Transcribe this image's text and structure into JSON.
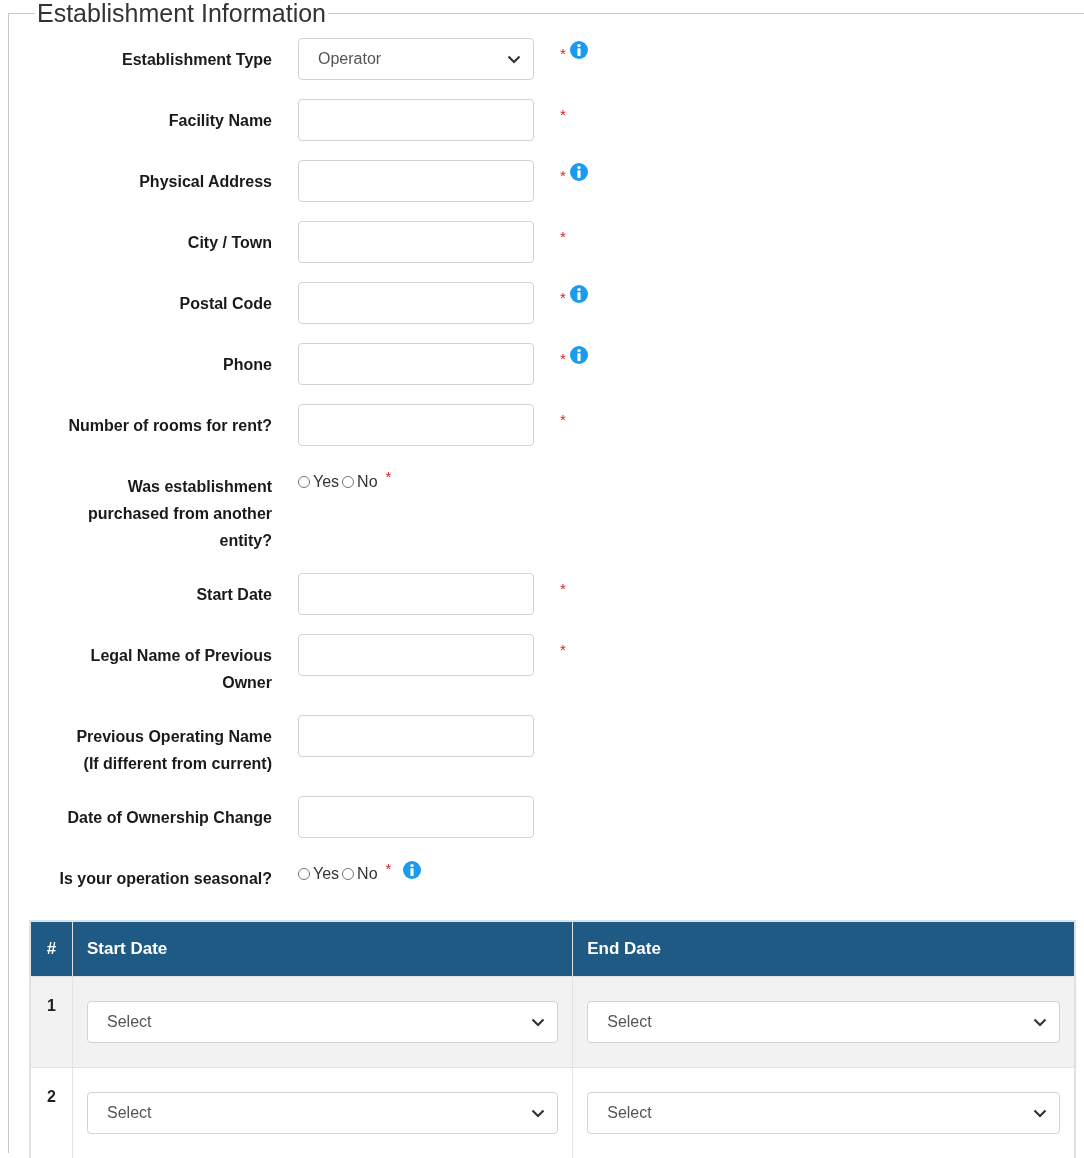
{
  "fieldset": {
    "legend": "Establishment Information"
  },
  "fields": [
    {
      "kind": "select",
      "label": "Establishment Type",
      "value": "Operator",
      "required_mark": "*",
      "info": true
    },
    {
      "kind": "text",
      "label": "Facility Name",
      "required_mark": "*",
      "info": false
    },
    {
      "kind": "text",
      "label": "Physical Address",
      "required_mark": "*",
      "info": true
    },
    {
      "kind": "text",
      "label": "City / Town",
      "required_mark": "*",
      "info": false
    },
    {
      "kind": "text",
      "label": "Postal Code",
      "required_mark": "*",
      "info": true
    },
    {
      "kind": "text",
      "label": "Phone",
      "required_mark": "*",
      "info": true
    },
    {
      "kind": "text",
      "label": "Number of rooms for rent?",
      "required_mark": "*",
      "info": false
    },
    {
      "kind": "radio",
      "label": "Was establishment\npurchased from another\nentity?",
      "options": [
        {
          "label": "Yes",
          "selected": false
        },
        {
          "label": "No",
          "selected": false
        }
      ],
      "required_mark": "*",
      "info": false
    },
    {
      "kind": "text",
      "label": "Start Date",
      "required_mark": "*",
      "info": false
    },
    {
      "kind": "text",
      "label": "Legal Name of Previous\nOwner",
      "required_mark": "*",
      "info": false
    },
    {
      "kind": "text",
      "label": "Previous Operating Name\n(If different from current)",
      "info": false
    },
    {
      "kind": "text",
      "label": "Date of Ownership Change",
      "info": false
    },
    {
      "kind": "radio",
      "label": "Is your operation seasonal?",
      "options": [
        {
          "label": "Yes",
          "selected": false
        },
        {
          "label": "No",
          "selected": false
        }
      ],
      "required_mark": "*",
      "info": true
    }
  ],
  "table": {
    "columns": [
      "#",
      "Start Date",
      "End Date"
    ],
    "rows": [
      {
        "number": "1",
        "start": "Select",
        "end": "Select"
      },
      {
        "number": "2",
        "start": "Select",
        "end": "Select"
      }
    ]
  }
}
